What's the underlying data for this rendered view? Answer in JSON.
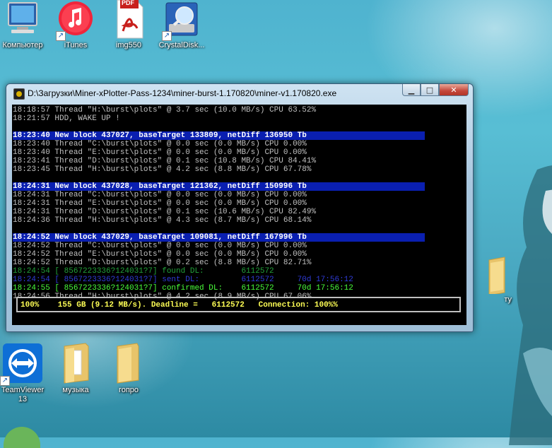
{
  "desktop": {
    "icons_top": [
      {
        "label": "Компьютер"
      },
      {
        "label": "iTunes"
      },
      {
        "label": "img550"
      },
      {
        "label": "CrystalDisk..."
      }
    ],
    "icons_bottom": [
      {
        "label_line1": "TeamViewer",
        "label_line2": "13"
      },
      {
        "label": "музыка"
      },
      {
        "label": "гопро"
      }
    ],
    "right_folder_label": "ту",
    "pdf_badge": "PDF"
  },
  "window": {
    "title": "D:\\Загрузки\\Miner-xPlotter-Pass-1234\\miner-burst-1.170820\\miner-v1.170820.exe",
    "buttons": {
      "minimize": "▁",
      "maximize": "□",
      "close": "✕"
    }
  },
  "console": {
    "lines": [
      {
        "kind": "normal",
        "text": "18:18:57 Thread \"H:\\burst\\plots\" @ 3.7 sec (10.0 MB/s) CPU 63.52%"
      },
      {
        "kind": "normal",
        "text": "18:21:57 HDD, WAKE UP !"
      },
      {
        "kind": "blank",
        "text": ""
      },
      {
        "kind": "block",
        "text": "18:23:40 New block 437027, baseTarget 133809, netDiff 136950 Tb"
      },
      {
        "kind": "normal",
        "text": "18:23:40 Thread \"C:\\burst\\plots\" @ 0.0 sec (0.0 MB/s) CPU 0.00%"
      },
      {
        "kind": "normal",
        "text": "18:23:40 Thread \"E:\\burst\\plots\" @ 0.0 sec (0.0 MB/s) CPU 0.00%"
      },
      {
        "kind": "normal",
        "text": "18:23:41 Thread \"D:\\burst\\plots\" @ 0.1 sec (10.8 MB/s) CPU 84.41%"
      },
      {
        "kind": "normal",
        "text": "18:23:45 Thread \"H:\\burst\\plots\" @ 4.2 sec (8.8 MB/s) CPU 67.78%"
      },
      {
        "kind": "blank",
        "text": ""
      },
      {
        "kind": "block",
        "text": "18:24:31 New block 437028, baseTarget 121362, netDiff 150996 Tb"
      },
      {
        "kind": "normal",
        "text": "18:24:31 Thread \"C:\\burst\\plots\" @ 0.0 sec (0.0 MB/s) CPU 0.00%"
      },
      {
        "kind": "normal",
        "text": "18:24:31 Thread \"E:\\burst\\plots\" @ 0.0 sec (0.0 MB/s) CPU 0.00%"
      },
      {
        "kind": "normal",
        "text": "18:24:31 Thread \"D:\\burst\\plots\" @ 0.1 sec (10.6 MB/s) CPU 82.49%"
      },
      {
        "kind": "normal",
        "text": "18:24:36 Thread \"H:\\burst\\plots\" @ 4.3 sec (8.7 MB/s) CPU 68.14%"
      },
      {
        "kind": "blank",
        "text": ""
      },
      {
        "kind": "block",
        "text": "18:24:52 New block 437029, baseTarget 109081, netDiff 167996 Tb"
      },
      {
        "kind": "normal",
        "text": "18:24:52 Thread \"C:\\burst\\plots\" @ 0.0 sec (0.0 MB/s) CPU 0.00%"
      },
      {
        "kind": "normal",
        "text": "18:24:52 Thread \"E:\\burst\\plots\" @ 0.0 sec (0.0 MB/s) CPU 0.00%"
      },
      {
        "kind": "normal",
        "text": "18:24:52 Thread \"D:\\burst\\plots\" @ 0.2 sec (8.8 MB/s) CPU 82.71%"
      },
      {
        "kind": "found",
        "text": "18:24:54 [ 8567223336?124031?7] found DL:        6112572"
      },
      {
        "kind": "sent",
        "text": "18:24:54 [ 8567223336?124031?7] sent DL:         6112572     70d 17:56:12"
      },
      {
        "kind": "confirmed",
        "text": "18:24:55 [ 8567223336?124031?7] confirmed DL:    6112572     70d 17:56:12"
      },
      {
        "kind": "normal",
        "text": "18:24:56 Thread \"H:\\burst\\plots\" @ 4.2 sec (8.9 MB/s) CPU 67.06%"
      }
    ],
    "status_line": "100%    155 GB (9.12 MB/s). Deadline =   6112572   Connection: 100%%"
  },
  "colors": {
    "console_bg": "#000000",
    "block_highlight": "#0a1fb0",
    "found": "#22a23a",
    "sent": "#2f3bd8",
    "confirmed": "#4aff3a",
    "status_text": "#ffff55"
  }
}
